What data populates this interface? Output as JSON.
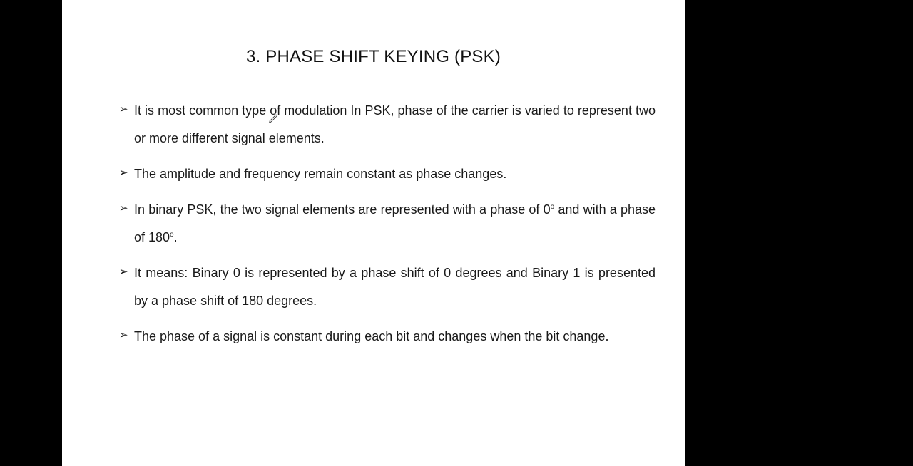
{
  "slide": {
    "title": "3. PHASE SHIFT KEYING (PSK)",
    "bullet_marker_icon": "arrowhead-bullet-icon",
    "bullets": [
      {
        "text": "It is most common type of modulation In PSK, phase of the carrier is varied to represent two or more different signal elements."
      },
      {
        "text": "The amplitude and frequency remain constant as phase changes."
      },
      {
        "text_1": "In binary PSK, the two signal elements are represented with a phase of 0",
        "sup_1": "o",
        "text_2": " and with a phase of 180",
        "sup_2": "o",
        "text_3": "."
      },
      {
        "text": "It means: Binary 0 is represented by a phase shift of 0 degrees and Binary 1 is presented by a phase shift of 180 degrees."
      },
      {
        "text": "The phase of a signal is constant during each bit and changes when the bit change."
      }
    ]
  },
  "pointer_icon": "pen-cursor-icon",
  "colors": {
    "background": "#000000",
    "slide": "#ffffff",
    "text": "#1a1a1a"
  }
}
